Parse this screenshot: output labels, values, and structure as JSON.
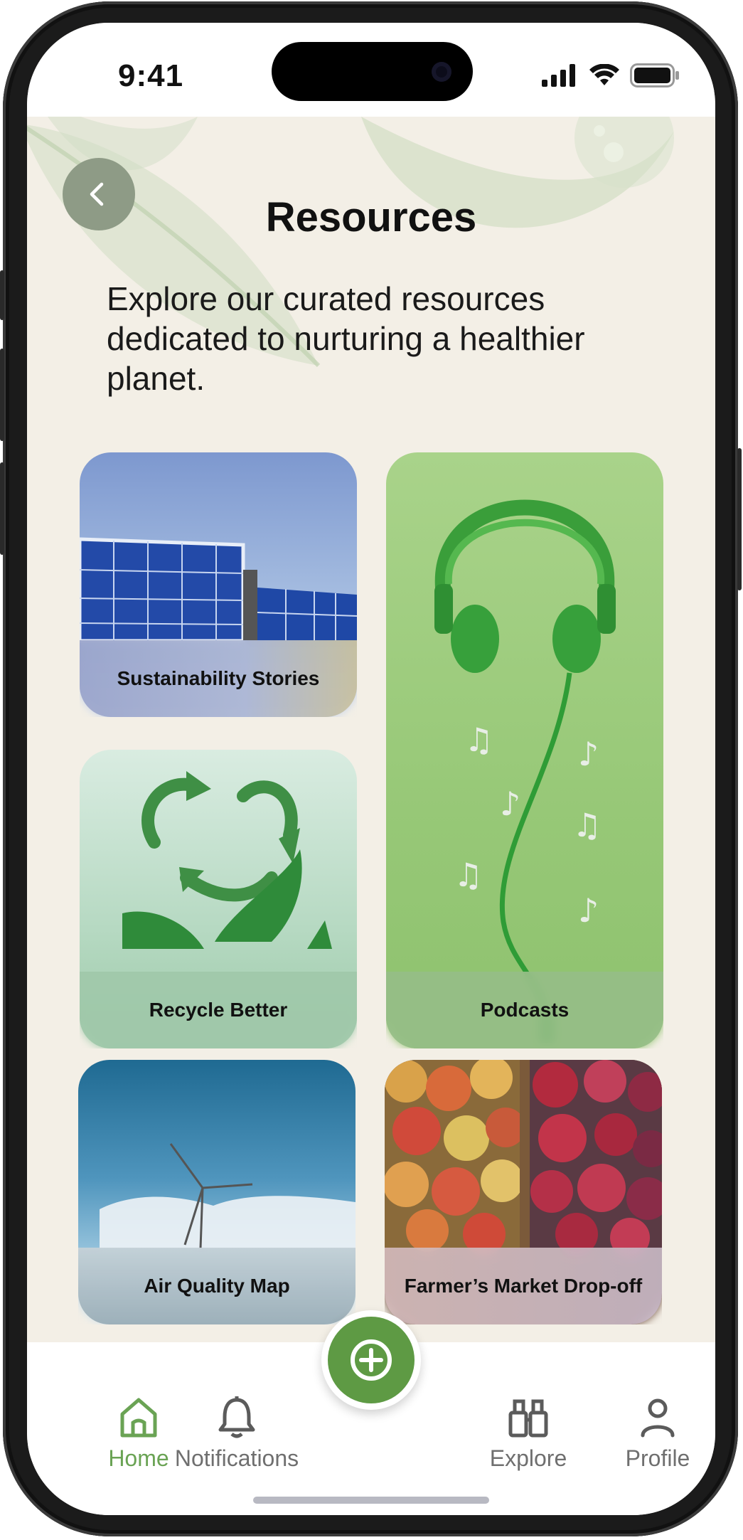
{
  "status_bar": {
    "time": "9:41"
  },
  "header": {
    "title": "Resources",
    "intro": "Explore our curated resources dedicated to nurturing a healthier planet."
  },
  "cards": {
    "sustainability": "Sustainability Stories",
    "podcasts": "Podcasts",
    "recycle": "Recycle Better",
    "air_quality": "Air Quality Map",
    "farmers_market": "Farmer’s Market Drop-off"
  },
  "nav": {
    "home": "Home",
    "notifications": "Notifications",
    "explore": "Explore",
    "profile": "Profile",
    "active": "home"
  },
  "colors": {
    "accent": "#6aa354",
    "fab": "#5e9a44",
    "background": "#f3efe6",
    "back_button": "#8e9b86"
  },
  "icons": {
    "back": "chevron-left-icon",
    "fab": "plus-circle-icon",
    "home": "home-icon",
    "notifications": "bell-icon",
    "explore": "binoculars-icon",
    "profile": "user-icon"
  }
}
